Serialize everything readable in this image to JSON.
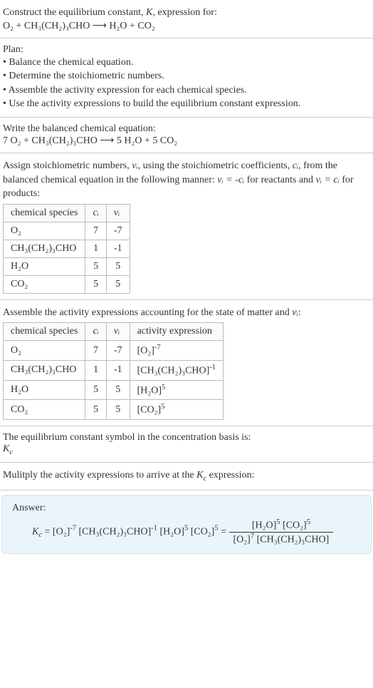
{
  "intro": {
    "line1_prefix": "Construct the equilibrium constant, ",
    "K": "K",
    "line1_suffix": ", expression for:",
    "equation": "O₂ + CH₃(CH₂)₃CHO ⟶ H₂O + CO₂"
  },
  "plan": {
    "title": "Plan:",
    "items": [
      "• Balance the chemical equation.",
      "• Determine the stoichiometric numbers.",
      "• Assemble the activity expression for each chemical species.",
      "• Use the activity expressions to build the equilibrium constant expression."
    ]
  },
  "balanced": {
    "title": "Write the balanced chemical equation:",
    "equation": "7 O₂ + CH₃(CH₂)₃CHO ⟶ 5 H₂O + 5 CO₂"
  },
  "assign": {
    "text_prefix": "Assign stoichiometric numbers, ",
    "nu_i": "νᵢ",
    "text_mid1": ", using the stoichiometric coefficients, ",
    "c_i": "cᵢ",
    "text_mid2": ", from the balanced chemical equation in the following manner: ",
    "eq1": "νᵢ = -cᵢ",
    "text_mid3": " for reactants and ",
    "eq2": "νᵢ = cᵢ",
    "text_end": " for products:",
    "headers": {
      "species": "chemical species",
      "ci": "cᵢ",
      "nui": "νᵢ"
    },
    "rows": [
      {
        "species": "O₂",
        "ci": "7",
        "nui": "-7"
      },
      {
        "species": "CH₃(CH₂)₃CHO",
        "ci": "1",
        "nui": "-1"
      },
      {
        "species": "H₂O",
        "ci": "5",
        "nui": "5"
      },
      {
        "species": "CO₂",
        "ci": "5",
        "nui": "5"
      }
    ]
  },
  "activity": {
    "text_prefix": "Assemble the activity expressions accounting for the state of matter and ",
    "nu_i": "νᵢ",
    "text_end": ":",
    "headers": {
      "species": "chemical species",
      "ci": "cᵢ",
      "nui": "νᵢ",
      "expr": "activity expression"
    },
    "rows": [
      {
        "species": "O₂",
        "ci": "7",
        "nui": "-7",
        "expr_base": "[O₂]",
        "expr_exp": "-7"
      },
      {
        "species": "CH₃(CH₂)₃CHO",
        "ci": "1",
        "nui": "-1",
        "expr_base": "[CH₃(CH₂)₃CHO]",
        "expr_exp": "-1"
      },
      {
        "species": "H₂O",
        "ci": "5",
        "nui": "5",
        "expr_base": "[H₂O]",
        "expr_exp": "5"
      },
      {
        "species": "CO₂",
        "ci": "5",
        "nui": "5",
        "expr_base": "[CO₂]",
        "expr_exp": "5"
      }
    ]
  },
  "symbol": {
    "text": "The equilibrium constant symbol in the concentration basis is:",
    "kc": "K",
    "c": "c"
  },
  "multiply": {
    "text_prefix": "Mulitply the activity expressions to arrive at the ",
    "kc": "K",
    "c": "c",
    "text_end": " expression:"
  },
  "answer": {
    "label": "Answer:",
    "kc": "K",
    "c": "c",
    "eq": " = ",
    "t1_base": "[O₂]",
    "t1_exp": "-7",
    "t2_base": "[CH₃(CH₂)₃CHO]",
    "t2_exp": "-1",
    "t3_base": "[H₂O]",
    "t3_exp": "5",
    "t4_base": "[CO₂]",
    "t4_exp": "5",
    "eq2": " = ",
    "num1_base": "[H₂O]",
    "num1_exp": "5",
    "num2_base": "[CO₂]",
    "num2_exp": "5",
    "den1_base": "[O₂]",
    "den1_exp": "7",
    "den2_base": "[CH₃(CH₂)₃CHO]"
  },
  "chart_data": {
    "type": "table",
    "tables": [
      {
        "title": "stoichiometric numbers",
        "columns": [
          "chemical species",
          "cᵢ",
          "νᵢ"
        ],
        "rows": [
          [
            "O₂",
            7,
            -7
          ],
          [
            "CH₃(CH₂)₃CHO",
            1,
            -1
          ],
          [
            "H₂O",
            5,
            5
          ],
          [
            "CO₂",
            5,
            5
          ]
        ]
      },
      {
        "title": "activity expressions",
        "columns": [
          "chemical species",
          "cᵢ",
          "νᵢ",
          "activity expression"
        ],
        "rows": [
          [
            "O₂",
            7,
            -7,
            "[O₂]^-7"
          ],
          [
            "CH₃(CH₂)₃CHO",
            1,
            -1,
            "[CH₃(CH₂)₃CHO]^-1"
          ],
          [
            "H₂O",
            5,
            5,
            "[H₂O]^5"
          ],
          [
            "CO₂",
            5,
            5,
            "[CO₂]^5"
          ]
        ]
      }
    ]
  }
}
